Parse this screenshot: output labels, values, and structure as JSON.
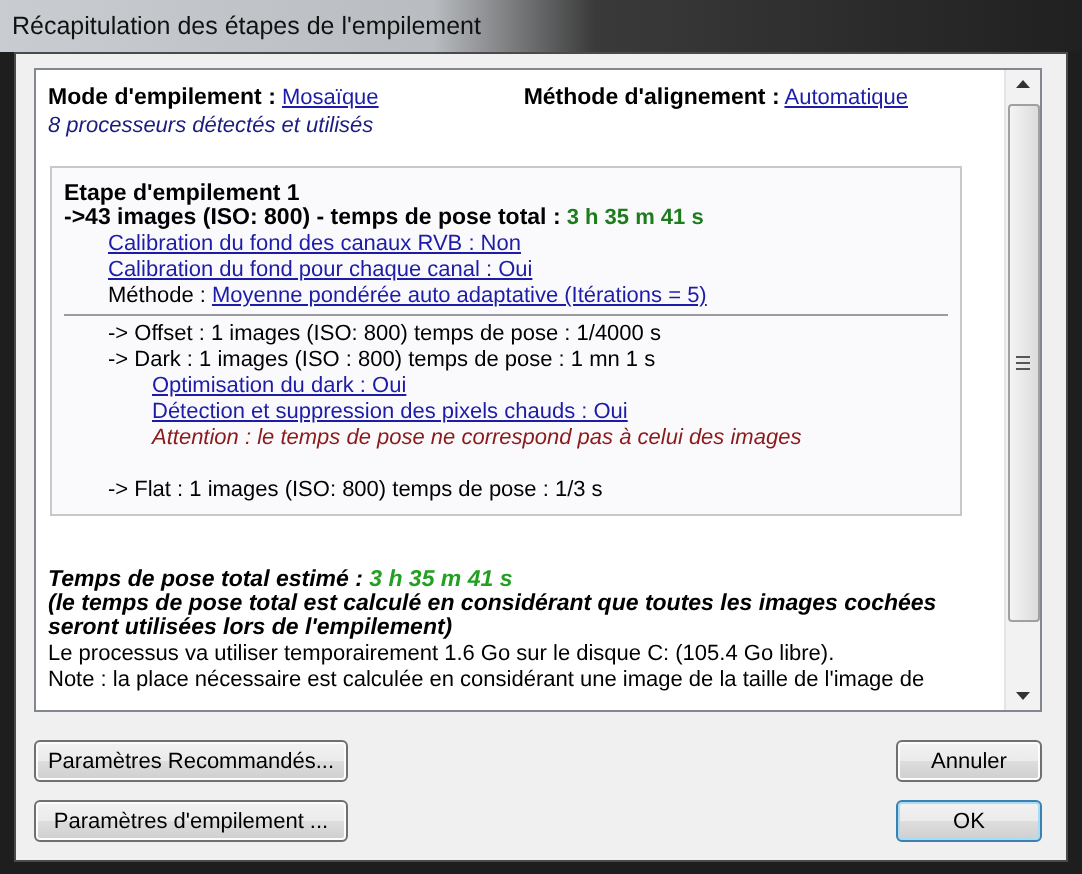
{
  "window": {
    "title": "Récapitulation des étapes de l'empilement"
  },
  "summary": {
    "mode_label": "Mode d'empilement :",
    "mode_value": "Mosaïque",
    "alignment_label": "Méthode d'alignement :",
    "alignment_value": "Automatique",
    "processors": "8 processeurs détectés et utilisés"
  },
  "stage": {
    "title": "Etape d'empilement 1",
    "lights_label": "->43 images (ISO: 800) - temps de pose total :",
    "lights_time": "3 h 35 m 41 s",
    "settings": [
      {
        "kind": "link",
        "text": "Calibration du fond des canaux RVB : Non"
      },
      {
        "kind": "link",
        "text": "Calibration du fond pour chaque canal : Oui"
      },
      {
        "kind": "method",
        "label": "Méthode :",
        "text": "Moyenne pondérée auto adaptative (Itérations = 5)"
      }
    ],
    "calibration": [
      {
        "text": "-> Offset : 1 images (ISO: 800) temps de pose : 1/4000 s"
      },
      {
        "text": "-> Dark : 1 images (ISO : 800) temps de pose : 1 mn 1 s",
        "children": [
          {
            "kind": "link",
            "text": "Optimisation du dark : Oui"
          },
          {
            "kind": "link",
            "text": "Détection et suppression des pixels chauds : Oui"
          },
          {
            "kind": "warning",
            "text": "Attention : le temps de pose ne correspond pas à celui des images"
          }
        ]
      },
      {
        "text": "-> Flat : 1 images (ISO: 800) temps de pose : 1/3 s"
      }
    ]
  },
  "estimate": {
    "label": "Temps de pose total estimé :",
    "time": "3 h 35 m 41 s",
    "note": "(le temps de pose total est calculé en considérant que toutes les images cochées seront utilisées lors de l'empilement)"
  },
  "disk": [
    "Le processus va utiliser temporairement 1.6 Go sur le disque C: (105.4 Go libre).",
    "Note : la place nécessaire est calculée en considérant une image de la taille de l'image de"
  ],
  "buttons_left": [
    {
      "label": "Paramètres Recommandés...",
      "default": false
    },
    {
      "label": "Paramètres d'empilement ...",
      "default": false
    }
  ],
  "buttons_right": [
    {
      "label": "Annuler",
      "default": false
    },
    {
      "label": "OK",
      "default": true
    }
  ]
}
